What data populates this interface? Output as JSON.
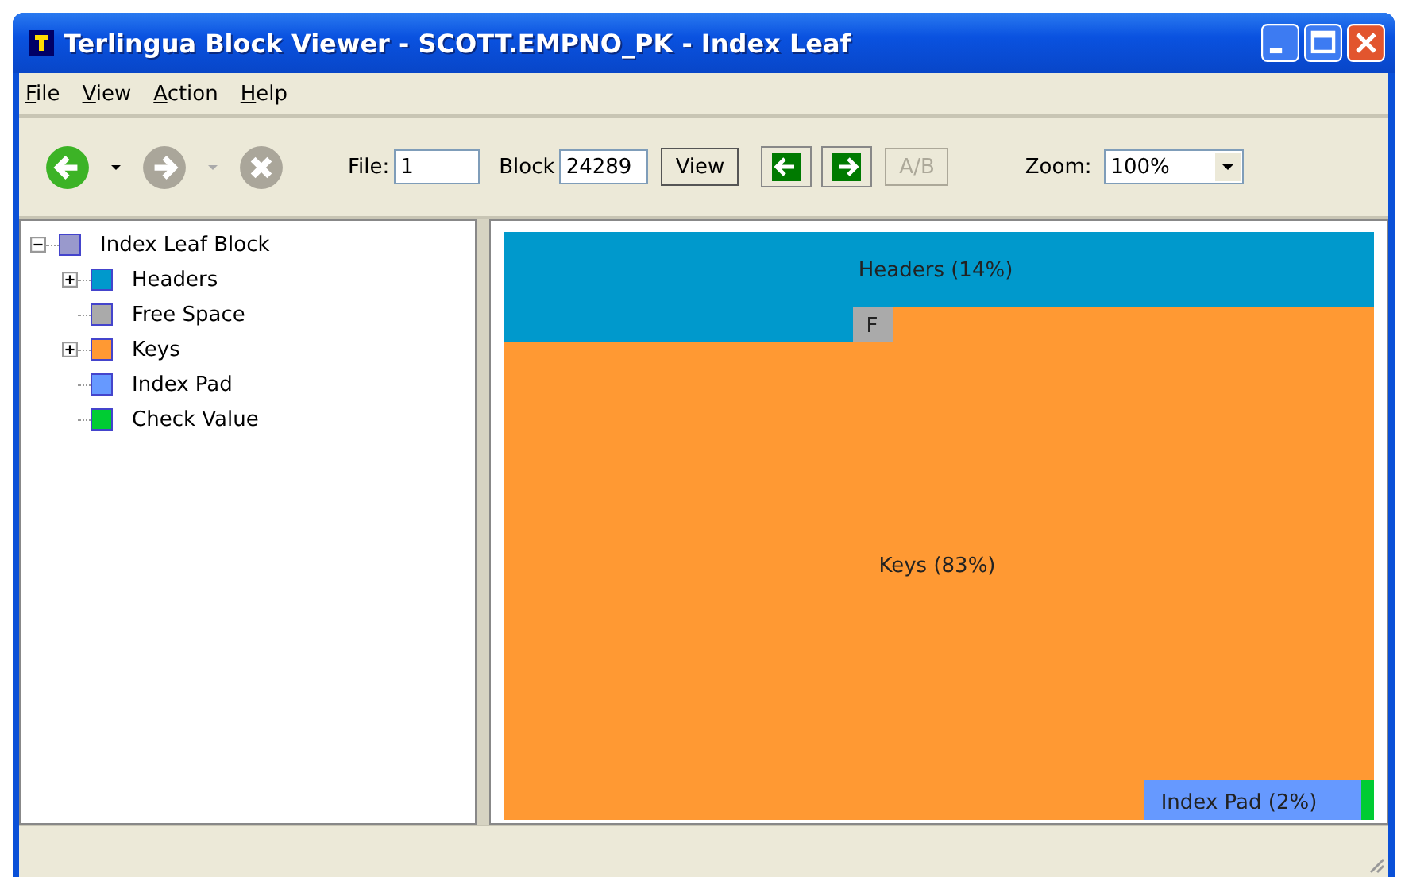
{
  "window": {
    "title": "Terlingua Block Viewer - SCOTT.EMPNO_PK - Index Leaf"
  },
  "menu": [
    "File",
    "View",
    "Action",
    "Help"
  ],
  "toolbar": {
    "back": {
      "disabled": false
    },
    "forward": {
      "disabled": true
    },
    "stop": {
      "disabled": true
    },
    "file_label": "File:",
    "file_value": "1",
    "block_label": "Block",
    "block_value": "24289",
    "view_button": "View",
    "ab_button": {
      "label": "A/B",
      "disabled": true
    },
    "zoom_label": "Zoom:",
    "zoom_value": "100%"
  },
  "tree": {
    "label": "Index Leaf Block",
    "color": "#9999cc",
    "expanded": true,
    "children": [
      {
        "label": "Headers",
        "color": "#0099cc",
        "expanded": false
      },
      {
        "label": "Free Space",
        "color": "#aaaaaa"
      },
      {
        "label": "Keys",
        "color": "#ff9933",
        "expanded": false
      },
      {
        "label": "Index Pad",
        "color": "#6699ff"
      },
      {
        "label": "Check Value",
        "color": "#00cc33"
      }
    ]
  },
  "map": {
    "blocks": [
      {
        "kind": "headers",
        "label": "Headers (14%)",
        "color": "#0099cc"
      },
      {
        "kind": "free",
        "label": "F",
        "color": "#aaaaaa"
      },
      {
        "kind": "keys",
        "label": "Keys (83%)",
        "color": "#ff9933"
      },
      {
        "kind": "index_pad",
        "label": "Index Pad (2%)",
        "color": "#6699ff"
      },
      {
        "kind": "check",
        "color": "#00cc33"
      }
    ]
  }
}
